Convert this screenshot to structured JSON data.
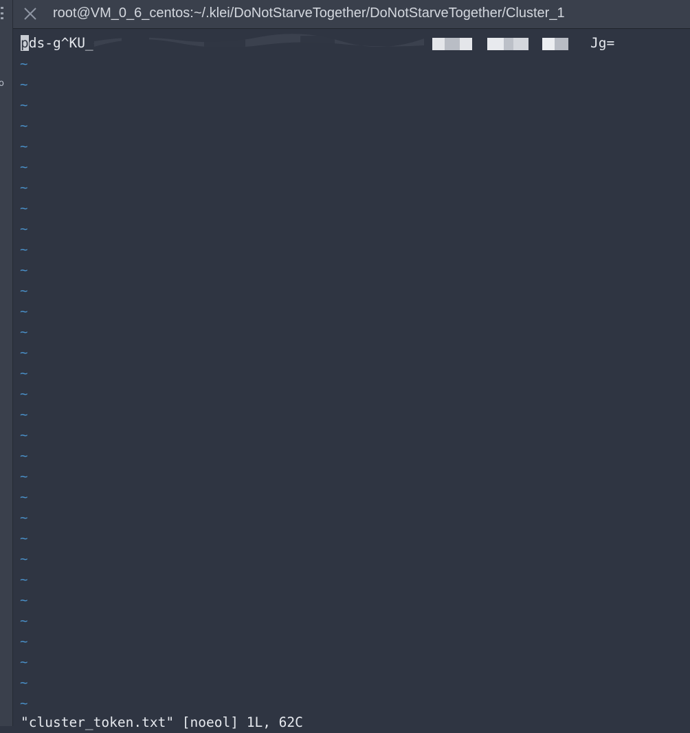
{
  "left_rail": {
    "glyph": "o"
  },
  "tab": {
    "title": "root@VM_0_6_centos:~/.klei/DoNotStarveTogether/DoNotStarveTogether/Cluster_1"
  },
  "buffer": {
    "cursor_char": "p",
    "line_visible_start": "ds-g^KU_qE/cUWNSPgWNTcSN+LBCNK/VVndVZPgHZC",
    "line_visible_end": "Jg=",
    "empty_line_marker": "~",
    "empty_line_count": 32
  },
  "status": {
    "message": "\"cluster_token.txt\" [noeol] 1L, 62C"
  },
  "colors": {
    "background": "#2f3542",
    "tilde": "#4a90c8",
    "text": "#e6e9ee"
  }
}
